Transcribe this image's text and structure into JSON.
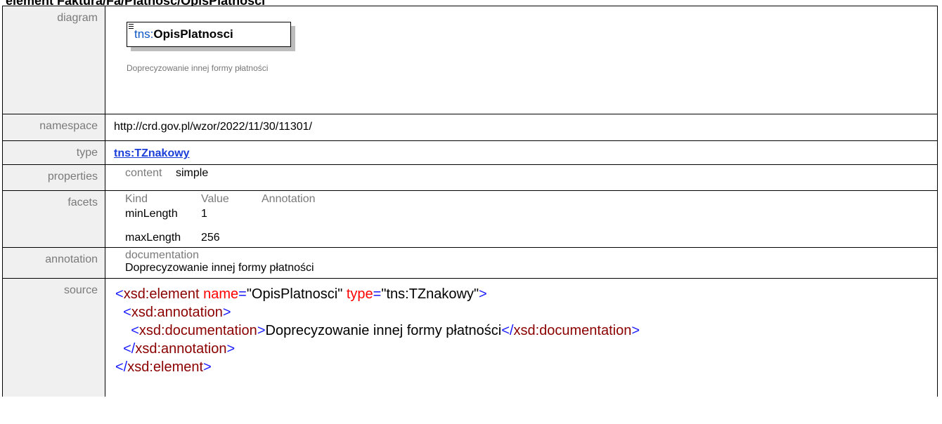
{
  "page_title": "element Faktura/Fa/Platnosc/OpisPlatnosci",
  "rows": {
    "diagram": {
      "label": "diagram",
      "element_prefix": "tns:",
      "element_name": "OpisPlatnosci",
      "element_doc": "Doprecyzowanie innej formy płatności"
    },
    "namespace": {
      "label": "namespace",
      "value": "http://crd.gov.pl/wzor/2022/11/30/11301/"
    },
    "type": {
      "label": "type",
      "value": "tns:TZnakowy"
    },
    "properties": {
      "label": "properties",
      "key": "content",
      "value": "simple"
    },
    "facets": {
      "label": "facets",
      "headers": [
        "Kind",
        "Value",
        "Annotation"
      ],
      "rows": [
        {
          "kind": "minLength",
          "value": "1"
        },
        {
          "kind": "maxLength",
          "value": "256"
        }
      ]
    },
    "annotation": {
      "label": "annotation",
      "header": "documentation",
      "text": "Doprecyzowanie innej formy płatności"
    },
    "source": {
      "label": "source",
      "open_tag": "xsd:element",
      "attr1_name": "name",
      "attr1_value": "\"OpisPlatnosci\"",
      "attr2_name": "type",
      "attr2_value": "\"tns:TZnakowy\"",
      "annotation_tag": "xsd:annotation",
      "documentation_tag": "xsd:documentation",
      "documentation_text": "Doprecyzowanie innej formy płatności"
    }
  },
  "colors": {
    "label_bg": "#f0f0f0",
    "label_text": "#7a7a7a",
    "xml_tag": "#1a1aff",
    "xml_tag_name": "#8b0000",
    "xml_attr_name": "#ff0000",
    "link": "#1a3ed8"
  }
}
